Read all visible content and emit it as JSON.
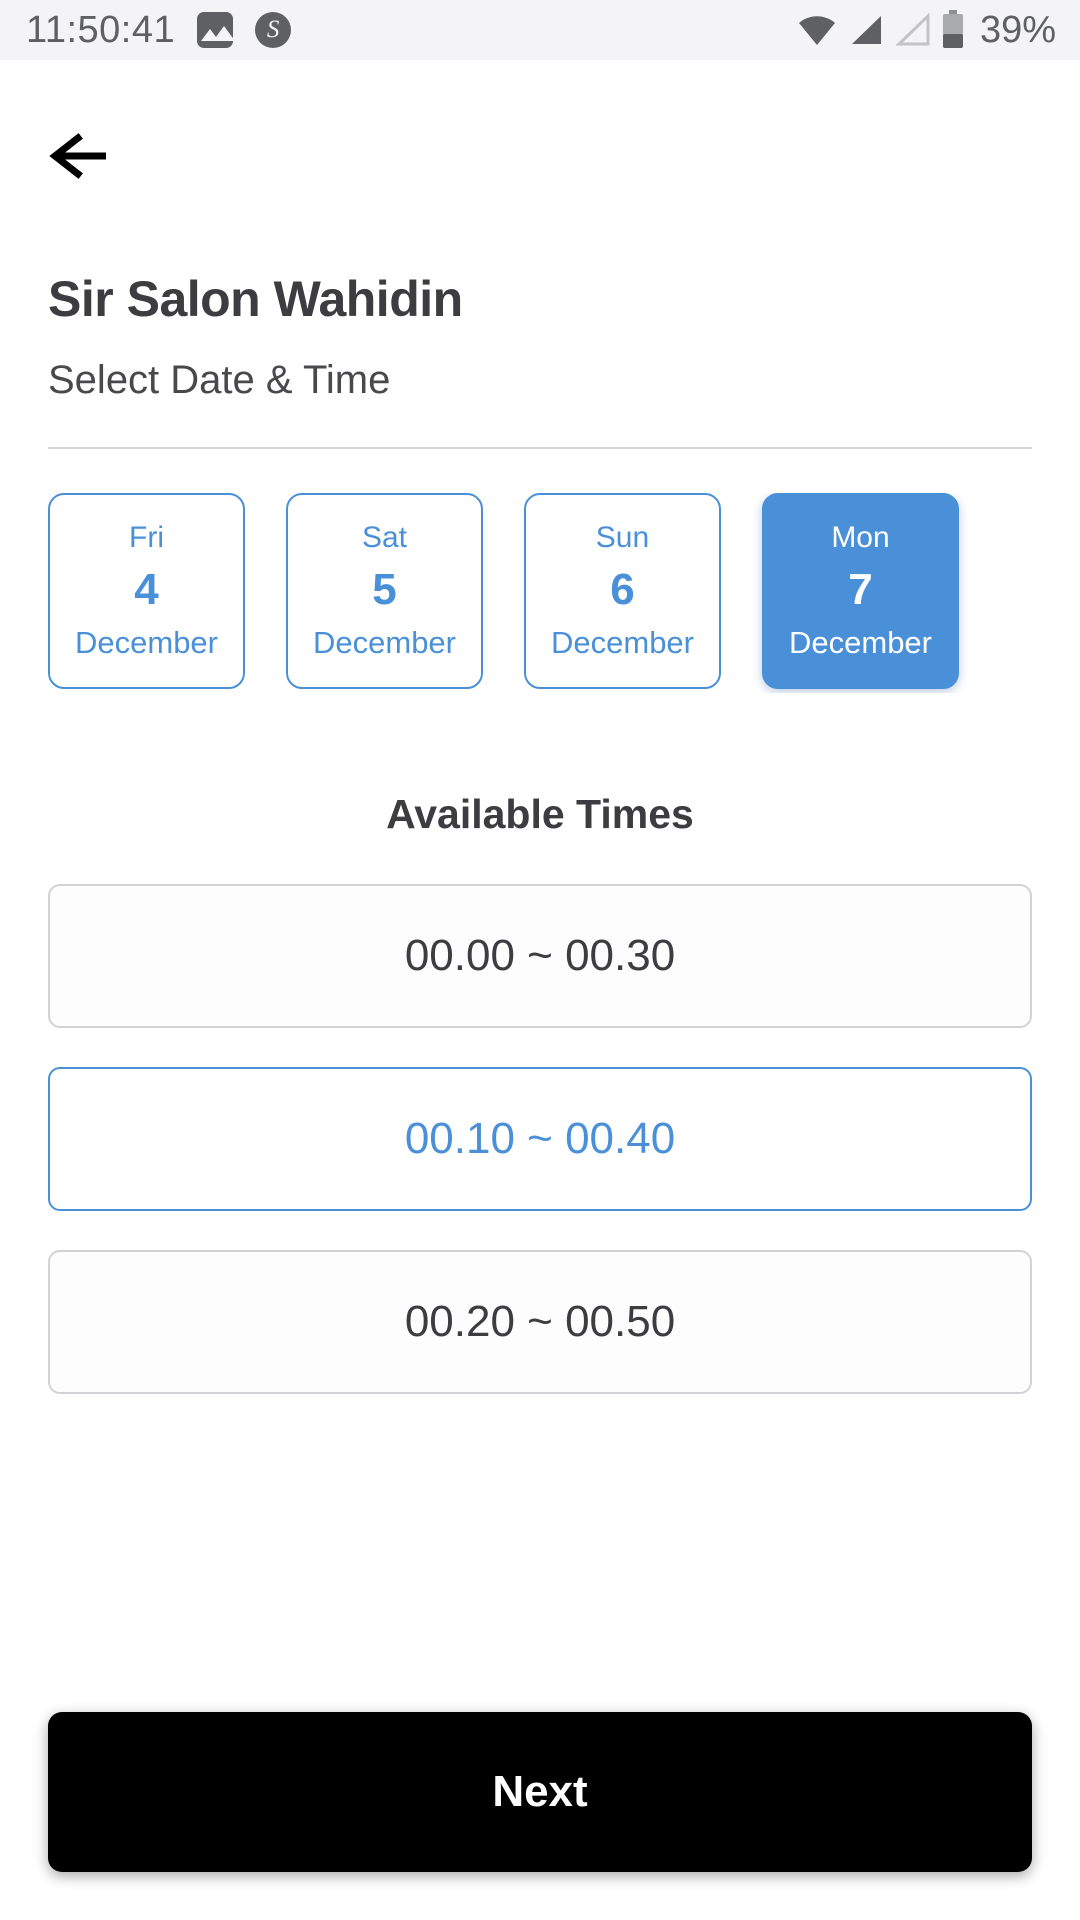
{
  "status_bar": {
    "clock": "11:50:41",
    "battery_percent": "39%",
    "icons": [
      "image-icon",
      "circle-s-icon",
      "wifi-icon",
      "signal-icon",
      "signal-alt-icon",
      "battery-icon"
    ],
    "bg_color": "#f4f4f6",
    "fg_color": "#5f6064"
  },
  "header": {
    "back_label": "back-arrow",
    "title": "Sir Salon Wahidin",
    "subtitle": "Select Date & Time"
  },
  "theme": {
    "accent": "#4a90d9",
    "text": "#3c3c41",
    "muted_border": "#d2d3d8",
    "button_bg": "#000000"
  },
  "dates": [
    {
      "dow": "Fri",
      "day": "4",
      "month": "December",
      "selected": false
    },
    {
      "dow": "Sat",
      "day": "5",
      "month": "December",
      "selected": false
    },
    {
      "dow": "Sun",
      "day": "6",
      "month": "December",
      "selected": false
    },
    {
      "dow": "Mon",
      "day": "7",
      "month": "December",
      "selected": true
    }
  ],
  "times_section": {
    "heading": "Available Times",
    "slots": [
      {
        "label": "00.00 ~ 00.30",
        "selected": false
      },
      {
        "label": "00.10 ~ 00.40",
        "selected": true
      },
      {
        "label": "00.20 ~ 00.50",
        "selected": false
      }
    ]
  },
  "footer": {
    "next_label": "Next"
  }
}
